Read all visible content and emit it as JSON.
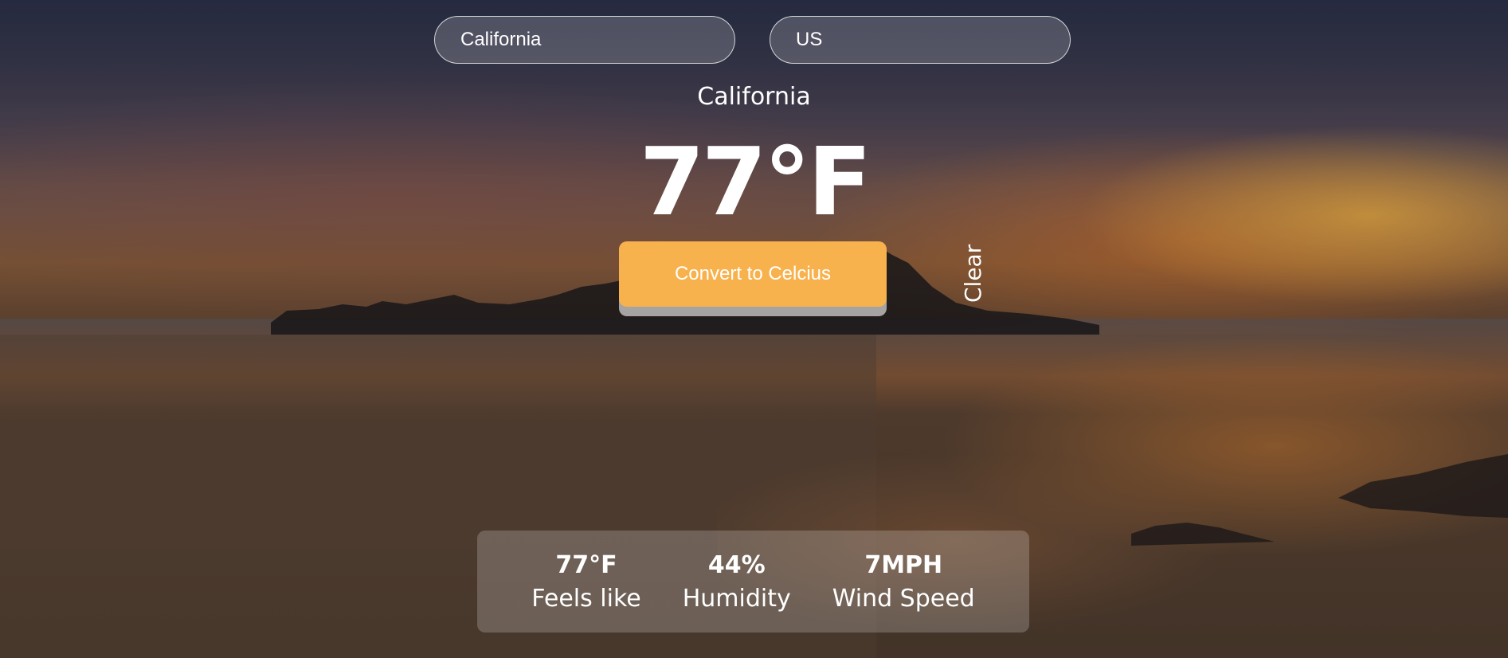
{
  "search": {
    "city_value": "California",
    "country_value": "US"
  },
  "weather": {
    "city_name": "California",
    "temperature": "77°F",
    "convert_label": "Convert to Celcius",
    "clear_label": "Clear"
  },
  "stats": [
    {
      "value": "77°F",
      "label": "Feels like"
    },
    {
      "value": "44%",
      "label": "Humidity"
    },
    {
      "value": "7MPH",
      "label": "Wind Speed"
    }
  ],
  "colors": {
    "accent": "#f8b24d",
    "text": "#ffffff"
  }
}
